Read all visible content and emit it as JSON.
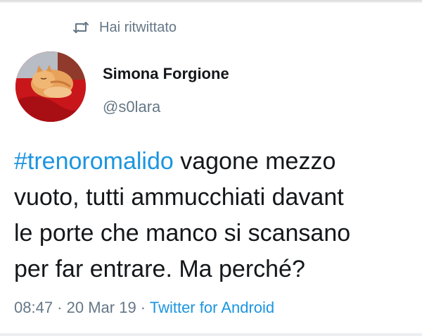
{
  "retweet": {
    "icon": "retweet-icon",
    "label": "Hai ritwittato"
  },
  "author": {
    "name": "Simona Forgione",
    "handle": "@s0lara",
    "avatar": "avatar-photo-orange-cat-on-red-blanket"
  },
  "tweet": {
    "hashtag": "#trenoromalido",
    "line1_rest": " vagone mezzo",
    "line2": "vuoto, tutti ammucchiati davant",
    "line3": "le porte che manco si scansano",
    "line4": "per far entrare. Ma perché?"
  },
  "meta": {
    "time": "08:47",
    "separator": " · ",
    "date": "20 Mar 19",
    "separator2": " · ",
    "source": "Twitter for Android"
  },
  "colors": {
    "text": "#14171a",
    "secondary": "#657786",
    "link": "#1b95e0",
    "avatar_bg": "#c9161b"
  }
}
